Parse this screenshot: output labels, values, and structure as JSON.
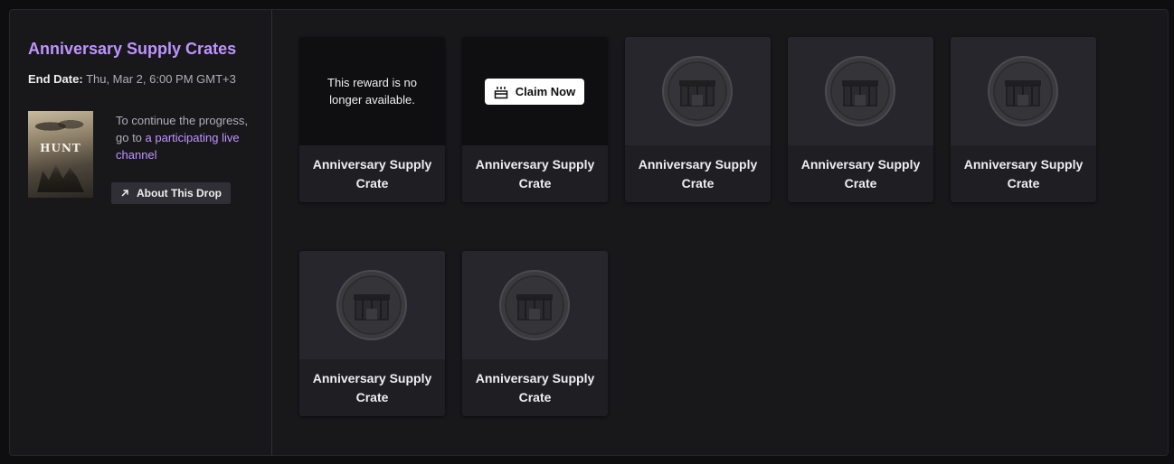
{
  "campaign": {
    "title": "Anniversary Supply Crates",
    "end_date_label": "End Date:",
    "end_date_value": "Thu, Mar 2, 6:00 PM GMT+3",
    "game_logo": "HUNT",
    "progress_prefix": "To continue the progress, go to ",
    "progress_link": "a participating live channel",
    "about_label": "About This Drop"
  },
  "rewards": [
    {
      "name": "Anniversary Supply Crate",
      "status": "expired",
      "status_text": "This reward is no longer available."
    },
    {
      "name": "Anniversary Supply Crate",
      "status": "claimable",
      "claim_label": "Claim Now"
    },
    {
      "name": "Anniversary Supply Crate",
      "status": "locked"
    },
    {
      "name": "Anniversary Supply Crate",
      "status": "locked"
    },
    {
      "name": "Anniversary Supply Crate",
      "status": "locked"
    },
    {
      "name": "Anniversary Supply Crate",
      "status": "locked"
    },
    {
      "name": "Anniversary Supply Crate",
      "status": "locked"
    }
  ],
  "colors": {
    "accent": "#bf94ff",
    "panel": "#18181b",
    "card": "#1f1f23"
  }
}
